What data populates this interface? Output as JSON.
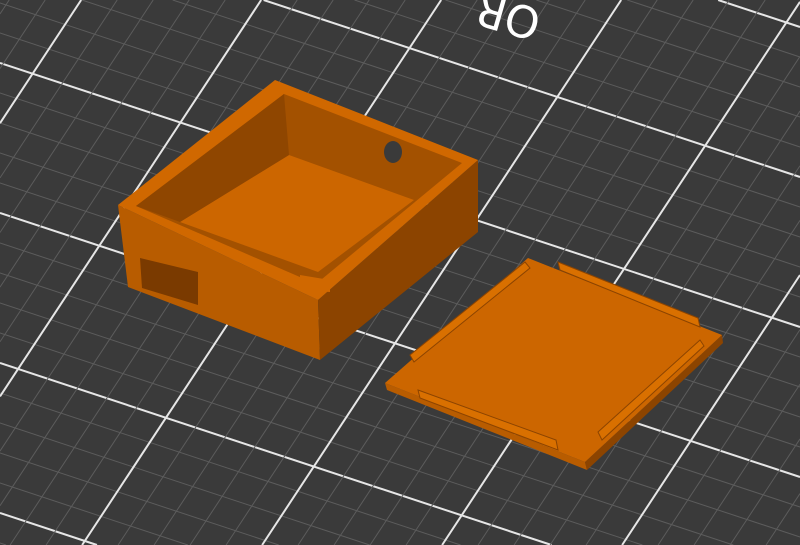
{
  "viewport": {
    "bed_label": "OR",
    "colors": {
      "background": "#3a3a3a",
      "grid_minor": "#5c5c5c",
      "grid_major": "#e6e6e6",
      "model_top": "#d06800",
      "model_front": "#b85c00",
      "model_side": "#8c4400",
      "model_inner": "#a35100"
    }
  }
}
